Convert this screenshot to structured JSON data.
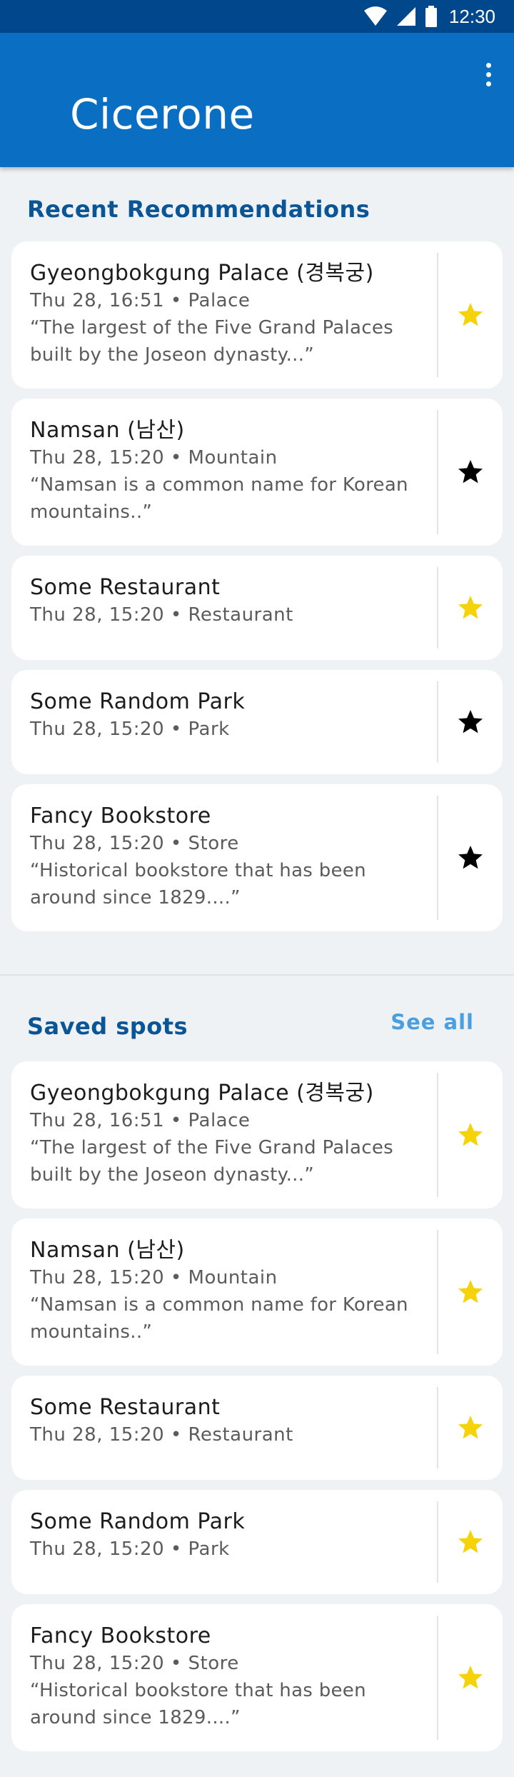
{
  "status_bar": {
    "time": "12:30"
  },
  "app_bar": {
    "title": "Cicerone"
  },
  "recent": {
    "title": "Recent Recommendations",
    "items": [
      {
        "name": "Gyeongbokgung Palace (경복궁)",
        "meta": "Thu 28, 16:51 • Palace",
        "desc": "“The largest of the Five Grand Palaces built by the Joseon dynasty...”",
        "starred": true
      },
      {
        "name": "Namsan (남산)",
        "meta": "Thu 28, 15:20 • Mountain",
        "desc": "“Namsan is a common name for Korean mountains..”",
        "starred": false
      },
      {
        "name": "Some Restaurant",
        "meta": "Thu 28, 15:20 • Restaurant",
        "desc": "",
        "starred": true
      },
      {
        "name": "Some Random Park",
        "meta": "Thu 28, 15:20 • Park",
        "desc": "",
        "starred": false
      },
      {
        "name": "Fancy Bookstore",
        "meta": "Thu 28, 15:20 • Store",
        "desc": "“Historical bookstore that has been around since 1829....”",
        "starred": false
      }
    ]
  },
  "saved": {
    "title": "Saved spots",
    "see_all": "See all",
    "items": [
      {
        "name": "Gyeongbokgung Palace (경복궁)",
        "meta": "Thu 28, 16:51 • Palace",
        "desc": "“The largest of the Five Grand Palaces built by the Joseon dynasty...”",
        "starred": true
      },
      {
        "name": "Namsan (남산)",
        "meta": "Thu 28, 15:20 • Mountain",
        "desc": "“Namsan is a common name for Korean mountains..”",
        "starred": true
      },
      {
        "name": "Some Restaurant",
        "meta": "Thu 28, 15:20 • Restaurant",
        "desc": "",
        "starred": true
      },
      {
        "name": "Some Random Park",
        "meta": "Thu 28, 15:20 • Park",
        "desc": "",
        "starred": true
      },
      {
        "name": "Fancy Bookstore",
        "meta": "Thu 28, 15:20 • Store",
        "desc": "“Historical bookstore that has been around since 1829....”",
        "starred": true
      }
    ]
  },
  "colors": {
    "status_bar": "#00478c",
    "app_bar": "#0a6fc2",
    "section_title": "#0a5596",
    "link": "#4a9fe0",
    "star_on": "#f5d20a",
    "star_off": "#000000",
    "background": "#eef2f5"
  },
  "icons": {
    "wifi": "wifi-icon",
    "signal": "cell-signal-icon",
    "battery": "battery-icon",
    "overflow": "more-vert-icon",
    "star": "star-icon"
  }
}
